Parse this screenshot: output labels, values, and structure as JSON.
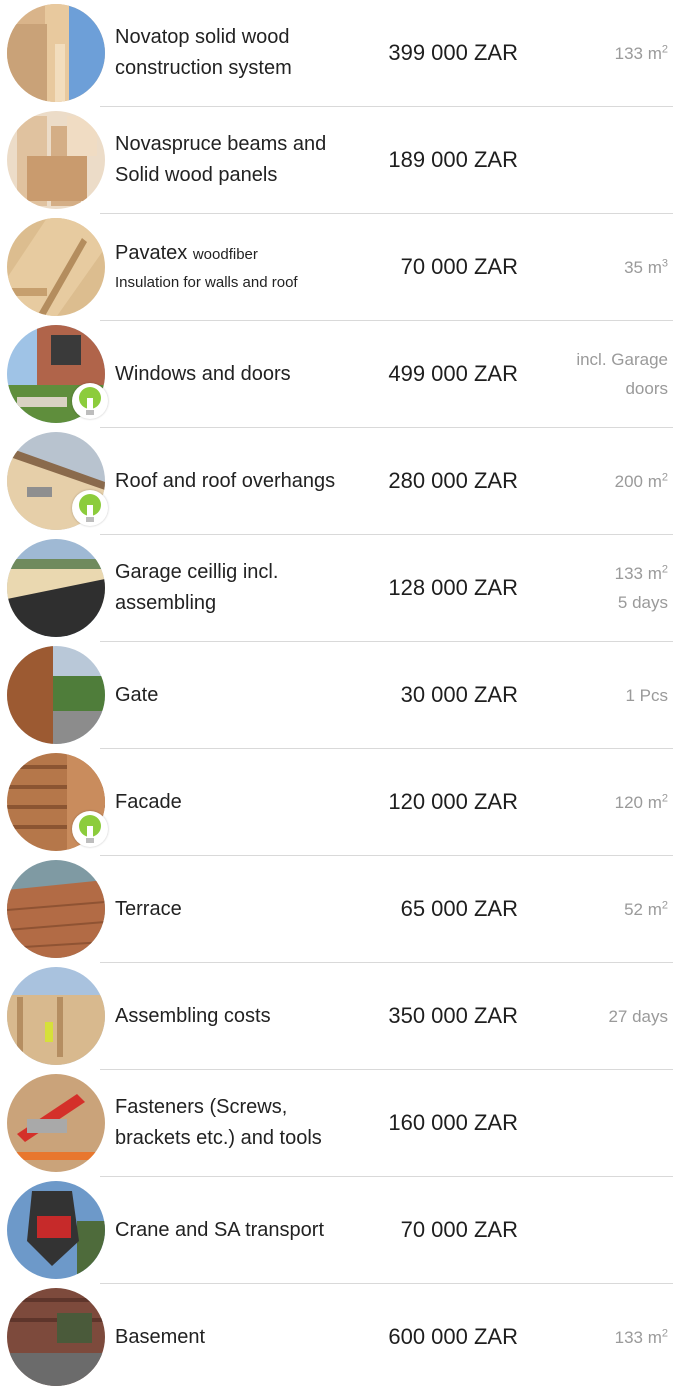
{
  "items": [
    {
      "name": "Novatop solid wood construction system",
      "price": "399 000 ZAR",
      "qty1": "133 m",
      "qty1_sup": "2",
      "qty2": ""
    },
    {
      "name": "Novaspruce beams and Solid wood panels",
      "price": "189 000 ZAR",
      "qty1": "",
      "qty1_sup": "",
      "qty2": ""
    },
    {
      "name": "Pavatex",
      "name_small": "woodfiber",
      "name_sub": "Insulation for walls and roof",
      "price": "70 000 ZAR",
      "qty1": "35 m",
      "qty1_sup": "3",
      "qty2": ""
    },
    {
      "name": "Windows and doors",
      "price": "499 000 ZAR",
      "qty1": "incl. Garage",
      "qty1_sup": "",
      "qty2": "doors"
    },
    {
      "name": "Roof and roof overhangs",
      "price": "280 000 ZAR",
      "qty1": "200 m",
      "qty1_sup": "2",
      "qty2": ""
    },
    {
      "name": "Garage ceillig incl. assembling",
      "price": "128 000 ZAR",
      "qty1": "133 m",
      "qty1_sup": "2",
      "qty2": "5 days"
    },
    {
      "name": "Gate",
      "price": "30 000 ZAR",
      "qty1": "1 Pcs",
      "qty1_sup": "",
      "qty2": ""
    },
    {
      "name": "Facade",
      "price": "120 000 ZAR",
      "qty1": "120 m",
      "qty1_sup": "2",
      "qty2": ""
    },
    {
      "name": "Terrace",
      "price": "65 000 ZAR",
      "qty1": "52 m",
      "qty1_sup": "2",
      "qty2": ""
    },
    {
      "name": "Assembling costs",
      "price": "350 000 ZAR",
      "qty1": "27 days",
      "qty1_sup": "",
      "qty2": ""
    },
    {
      "name": "Fasteners (Screws, brackets etc.) and tools",
      "price": "160 000 ZAR",
      "qty1": "",
      "qty1_sup": "",
      "qty2": ""
    },
    {
      "name": "Crane and SA transport",
      "price": "70 000 ZAR",
      "qty1": "",
      "qty1_sup": "",
      "qty2": ""
    },
    {
      "name": "Basement",
      "price": "600 000 ZAR",
      "qty1": "133 m",
      "qty1_sup": "2",
      "qty2": ""
    }
  ],
  "thumbnail_icons": [
    "solid-wood-panel-photo",
    "spruce-beams-photo",
    "woodfiber-board-photo",
    "house-windows-photo",
    "roof-overhang-photo",
    "garage-ceiling-photo",
    "wooden-gate-photo",
    "wood-facade-photo",
    "wood-terrace-photo",
    "assembling-site-photo",
    "fasteners-tools-photo",
    "crane-hook-photo",
    "basement-photo"
  ],
  "eco_badge_icon": "green-tree-lightbulb-icon",
  "colors": {
    "text": "#1e1e1e",
    "muted": "#9a9a9a",
    "divider": "#d9d9d9",
    "eco_green": "#8ccc3c"
  }
}
